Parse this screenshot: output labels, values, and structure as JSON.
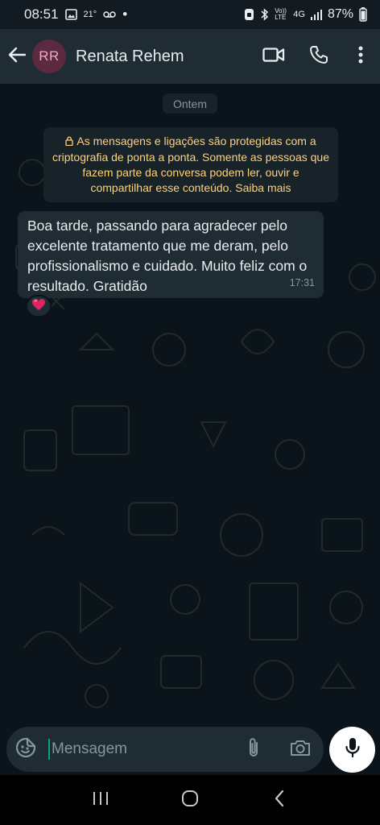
{
  "status_bar": {
    "time": "08:51",
    "temperature": "21°",
    "dot": "•",
    "volte": "Vo)) LTE",
    "network": "4G",
    "battery": "87%"
  },
  "header": {
    "avatar_initials": "RR",
    "contact_name": "Renata Rehem",
    "icons": [
      "back-arrow-icon",
      "video-call-icon",
      "phone-icon",
      "more-options-icon"
    ]
  },
  "chat": {
    "date_chip": "Ontem",
    "encryption_notice": "As mensagens e ligações são protegidas com a criptografia de ponta a ponta. Somente as pessoas que fazem parte da conversa podem ler, ouvir e compartilhar esse conteúdo. Saiba mais",
    "messages": [
      {
        "text": "Boa tarde, passando para agradecer pelo excelente tratamento que me deram, pelo profissionalismo e cuidado. Muito feliz com o resultado. Gratidão",
        "time": "17:31",
        "reaction": "heart"
      }
    ]
  },
  "input": {
    "placeholder": "Mensagem",
    "icons": [
      "sticker-icon",
      "attach-icon",
      "camera-icon",
      "mic-icon"
    ]
  },
  "colors": {
    "background": "#0b141a",
    "header": "#1f2c34",
    "bubble": "#202c33",
    "notice_text": "#ffd279",
    "accent": "#00a884"
  }
}
